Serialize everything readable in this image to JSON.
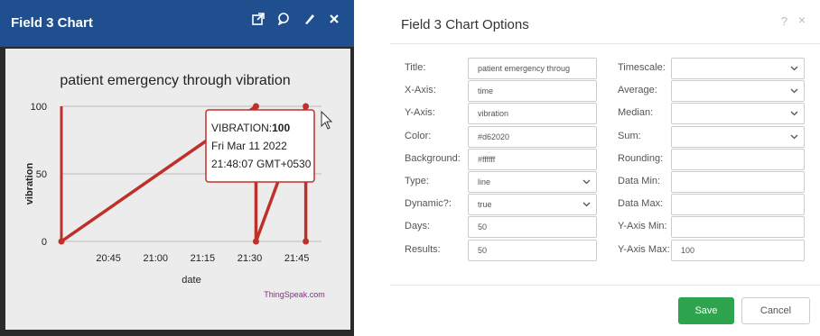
{
  "widget": {
    "title": "Field 3 Chart",
    "icons": [
      "external-link-icon",
      "comment-icon",
      "pencil-icon",
      "close-icon"
    ],
    "watermark": "ThingSpeak.com",
    "tooltip": {
      "label": "VIBRATION:",
      "value": "100",
      "date": "Fri Mar 11 2022",
      "time": "21:48:07 GMT+0530"
    }
  },
  "chart_data": {
    "type": "line",
    "title": "patient emergency through vibration",
    "xlabel": "date",
    "ylabel": "vibration",
    "x_ticks": [
      "20:45",
      "21:00",
      "21:15",
      "21:30",
      "21:45"
    ],
    "y_ticks": [
      "0",
      "50",
      "100"
    ],
    "ylim": [
      0,
      100
    ],
    "color": "#c0302b",
    "series": [
      {
        "x": [
          "20:45",
          "21:32",
          "21:32",
          "21:45",
          "21:45"
        ],
        "y": [
          0,
          100,
          0,
          100,
          0
        ]
      }
    ],
    "grid": true
  },
  "dialog": {
    "title": "Field 3 Chart Options",
    "help": "?",
    "close": "×",
    "left_fields": [
      {
        "label": "Title:",
        "value": "patient emergency throug",
        "type": "text"
      },
      {
        "label": "X-Axis:",
        "value": "time",
        "type": "text"
      },
      {
        "label": "Y-Axis:",
        "value": "vibration",
        "type": "text"
      },
      {
        "label": "Color:",
        "value": "#d62020",
        "type": "text"
      },
      {
        "label": "Background:",
        "value": "#ffffff",
        "type": "text"
      },
      {
        "label": "Type:",
        "value": "line",
        "type": "select"
      },
      {
        "label": "Dynamic?:",
        "value": "true",
        "type": "select"
      },
      {
        "label": "Days:",
        "value": "50",
        "type": "text"
      },
      {
        "label": "Results:",
        "value": "50",
        "type": "text"
      }
    ],
    "right_fields": [
      {
        "label": "Timescale:",
        "value": "",
        "type": "select"
      },
      {
        "label": "Average:",
        "value": "",
        "type": "select"
      },
      {
        "label": "Median:",
        "value": "",
        "type": "select"
      },
      {
        "label": "Sum:",
        "value": "",
        "type": "select"
      },
      {
        "label": "Rounding:",
        "value": "",
        "type": "text"
      },
      {
        "label": "Data Min:",
        "value": "",
        "type": "text"
      },
      {
        "label": "Data Max:",
        "value": "",
        "type": "text"
      },
      {
        "label": "Y-Axis Min:",
        "value": "",
        "type": "text"
      },
      {
        "label": "Y-Axis Max:",
        "value": "100",
        "type": "text"
      }
    ],
    "save_label": "Save",
    "cancel_label": "Cancel"
  }
}
